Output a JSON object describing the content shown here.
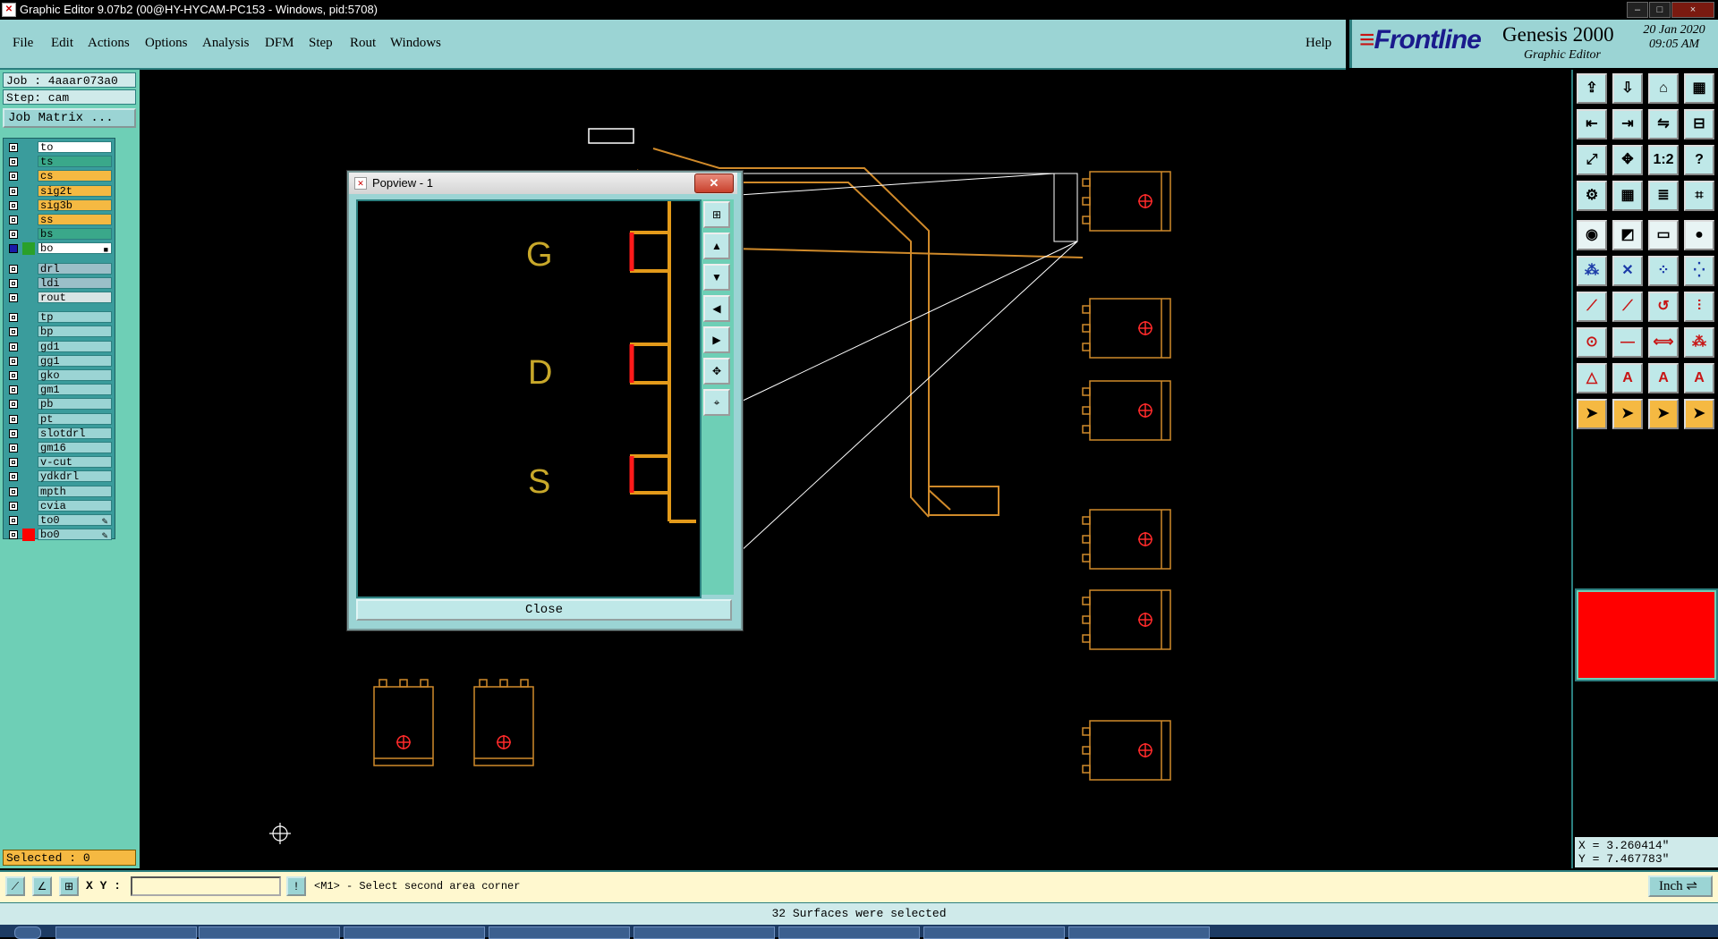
{
  "window": {
    "title": "Graphic Editor 9.07b2 (00@HY-HYCAM-PC153 - Windows, pid:5708)",
    "minimize": "–",
    "maximize": "□",
    "close": "×"
  },
  "menu": [
    "File",
    "Edit",
    "Actions",
    "Options",
    "Analysis",
    "DFM",
    "Step",
    "Rout",
    "Windows"
  ],
  "help_label": "Help",
  "brand": {
    "logo": "Frontline",
    "product": "Genesis 2000",
    "subtitle": "Graphic Editor",
    "date": "20 Jan 2020",
    "time": "09:05 AM"
  },
  "job": "Job : 4aaar073a0",
  "step": "Step: cam",
  "job_matrix_label": "Job Matrix ...",
  "layers": [
    {
      "name": "to",
      "color": "#ffffff",
      "checked": false
    },
    {
      "name": "ts",
      "color": "#3aa88a",
      "checked": false
    },
    {
      "name": "cs",
      "color": "#f5b942",
      "checked": false
    },
    {
      "name": "sig2t",
      "color": "#f5b942",
      "checked": false
    },
    {
      "name": "sig3b",
      "color": "#f5b942",
      "checked": false
    },
    {
      "name": "ss",
      "color": "#f5b942",
      "checked": false
    },
    {
      "name": "bs",
      "color": "#3aa88a",
      "checked": false
    },
    {
      "name": "bo",
      "color": "#ffffff",
      "checked": true,
      "swatch": "#2aa02a",
      "mark": "■"
    },
    {
      "name": "drl",
      "color": "#9bbfc8",
      "checked": false
    },
    {
      "name": "ldi",
      "color": "#9bbfc8",
      "checked": false
    },
    {
      "name": "rout",
      "color": "#d8e4e4",
      "checked": false
    },
    {
      "name": "tp",
      "color": "#9bd4d4",
      "checked": false
    },
    {
      "name": "bp",
      "color": "#9bd4d4",
      "checked": false
    },
    {
      "name": "gd1",
      "color": "#9bd4d4",
      "checked": false
    },
    {
      "name": "gg1",
      "color": "#9bd4d4",
      "checked": false
    },
    {
      "name": "gko",
      "color": "#9bd4d4",
      "checked": false
    },
    {
      "name": "gm1",
      "color": "#9bd4d4",
      "checked": false
    },
    {
      "name": "pb",
      "color": "#9bd4d4",
      "checked": false
    },
    {
      "name": "pt",
      "color": "#9bd4d4",
      "checked": false
    },
    {
      "name": "slotdrl",
      "color": "#9bd4d4",
      "checked": false
    },
    {
      "name": "gm16",
      "color": "#9bd4d4",
      "checked": false
    },
    {
      "name": "v-cut",
      "color": "#9bd4d4",
      "checked": false
    },
    {
      "name": "ydkdrl",
      "color": "#9bd4d4",
      "checked": false
    },
    {
      "name": "mpth",
      "color": "#9bd4d4",
      "checked": false
    },
    {
      "name": "cvia",
      "color": "#9bd4d4",
      "checked": false
    },
    {
      "name": "to0",
      "color": "#9bd4d4",
      "checked": false,
      "mark": "✎"
    },
    {
      "name": "bo0",
      "color": "#9bd4d4",
      "checked": false,
      "swatch": "#ff0000",
      "mark": "✎"
    }
  ],
  "selected": "Selected : 0",
  "popview": {
    "title": "Popview - 1",
    "labels": [
      "G",
      "D",
      "S"
    ],
    "close_label": "Close"
  },
  "coords": {
    "x": "X = 3.260414\"",
    "y": "Y = 7.467783\""
  },
  "cmd": {
    "xy_label": "X Y :",
    "xy_value": "",
    "prompt": "<M1> - Select second area corner",
    "unit": "Inch"
  },
  "status": "32 Surfaces were selected",
  "toolbar_icons": [
    "open-job-icon",
    "save-icon",
    "home-icon",
    "layout-icon",
    "zoom-left-icon",
    "zoom-right-icon",
    "swap-icon",
    "split-icon",
    "fit-icon",
    "center-icon",
    "ratio-icon",
    "help-icon",
    "measure-icon",
    "grid-icon",
    "layers-icon",
    "snap-icon",
    "pad-icon",
    "line-draw-icon",
    "ruler-icon",
    "circle-icon",
    "connect-icon",
    "cross-icon",
    "node-icon",
    "net-icon",
    "trace-icon",
    "route-icon",
    "arc-icon",
    "filter-icon",
    "drill-icon",
    "minus-icon",
    "dimension-icon",
    "cluster-icon",
    "triangle-icon",
    "text-a-icon",
    "text-b-icon",
    "text-c-icon",
    "select-icon",
    "select-point-icon",
    "select-area-icon",
    "select-path-icon"
  ]
}
